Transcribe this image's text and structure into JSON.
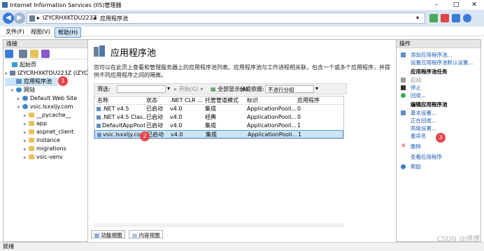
{
  "window": {
    "title": "Internet Information Services (IIS)管理器"
  },
  "address": {
    "host": "IZYCRHXKTDU223Z",
    "page": "应用程序池"
  },
  "menu": {
    "file": "文件(F)",
    "view": "视图(V)",
    "help": "帮助(H)"
  },
  "left": {
    "header": "连接",
    "tree": {
      "start": "起始页",
      "server": "IZYCRHXKTDU223Z (IZYCR",
      "pools": "应用程序池",
      "sites": "网站",
      "default_site": "Default Web Site",
      "vsic": "vsic.lsxxljy.com",
      "folders": [
        "__pycache__",
        "app",
        "aspnet_client",
        "instance",
        "migrations",
        "vsic-venv"
      ]
    }
  },
  "center": {
    "title": "应用程序池",
    "desc": "您可以在此页上查看和管理服务器上的应用程序池列表。应用程序池与工作进程相关联，包含一个或多个应用程序，并提供不同应用程序之间的隔离。",
    "filter_label": "筛选:",
    "start": "开始(G)",
    "showall": "全部显示(A)",
    "group_label": "分组依据:",
    "group_value": "不进行分组",
    "columns": [
      "名称",
      "状态",
      ".NET CLR ...",
      "托管管道模式",
      "标识",
      "应用程序"
    ],
    "rows": [
      [
        ".NET v4.5",
        "已启动",
        "v4.0",
        "集成",
        "ApplicationPooli...",
        "0"
      ],
      [
        ".NET v4.5 Clas...",
        "已启动",
        "v4.0",
        "经典",
        "ApplicationPooli...",
        "0"
      ],
      [
        "DefaultAppPool",
        "已启动",
        "v4.0",
        "集成",
        "ApplicationPooli...",
        "1"
      ],
      [
        "vsic.lsxxljy.com",
        "已启动",
        "v4.0",
        "集成",
        "ApplicationPooli...",
        "1"
      ]
    ],
    "tab_features": "功能视图",
    "tab_content": "内容视图"
  },
  "right": {
    "header": "操作",
    "add_pool": "添加应用程序池...",
    "set_defaults": "设置应用程序池默认设置...",
    "tasks_header": "应用程序池任务",
    "start": "启动",
    "stop": "停止",
    "recycle": "回收...",
    "edit_header": "编辑应用程序池",
    "basic": "基本设置...",
    "recycling": "正在回收...",
    "advanced": "高级设置...",
    "rename": "重命名",
    "delete": "删除",
    "view_apps": "查看应用程序",
    "help": "帮助"
  },
  "badges": {
    "b1": "1",
    "b2": "2",
    "b3": "3"
  },
  "status": {
    "text": "就绪"
  },
  "watermark": "CSDN @博博"
}
